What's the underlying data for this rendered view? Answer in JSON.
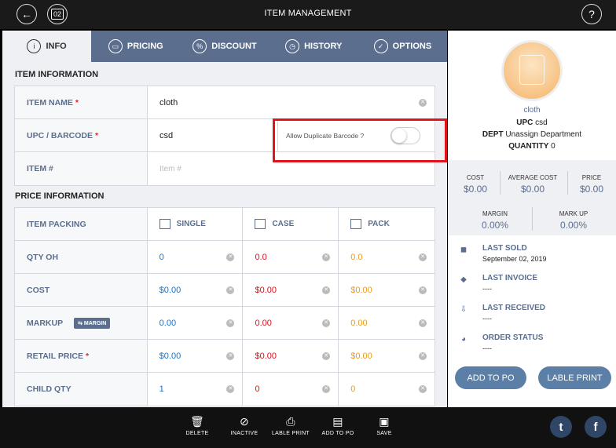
{
  "header": {
    "title": "ITEM MANAGEMENT",
    "back_icon": "←",
    "calendar_label": "02",
    "help_icon": "?"
  },
  "tabs": [
    {
      "label": "INFO",
      "icon": "i"
    },
    {
      "label": "PRICING",
      "icon": "▭"
    },
    {
      "label": "DISCOUNT",
      "icon": "%"
    },
    {
      "label": "HISTORY",
      "icon": "◷"
    },
    {
      "label": "OPTIONS",
      "icon": "✓"
    }
  ],
  "item_info": {
    "title": "ITEM INFORMATION",
    "item_name": {
      "label": "ITEM NAME",
      "value": "cloth"
    },
    "upc": {
      "label": "UPC / BARCODE",
      "value": "csd"
    },
    "allow_duplicate": {
      "label": "Allow Duplicate Barcode ?",
      "enabled": false
    },
    "item_number": {
      "label": "ITEM #",
      "placeholder": "Item #"
    }
  },
  "price_info": {
    "title": "PRICE INFORMATION",
    "packing_label": "ITEM PACKING",
    "columns": [
      "SINGLE",
      "CASE",
      "PACK"
    ],
    "rows": [
      {
        "label": "QTY OH",
        "required": false,
        "values": [
          "0",
          "0.0",
          "0.0"
        ]
      },
      {
        "label": "COST",
        "required": false,
        "values": [
          "$0.00",
          "$0.00",
          "$0.00"
        ]
      },
      {
        "label": "MARKUP",
        "required": false,
        "badge": "MARGIN",
        "values": [
          "0.00",
          "0.00",
          "0.00"
        ]
      },
      {
        "label": "RETAIL PRICE",
        "required": true,
        "values": [
          "$0.00",
          "$0.00",
          "$0.00"
        ]
      },
      {
        "label": "CHILD QTY",
        "required": false,
        "values": [
          "1",
          "0",
          "0"
        ]
      }
    ]
  },
  "summary": {
    "name": "cloth",
    "upc_label": "UPC",
    "upc_value": "csd",
    "dept_label": "DEPT",
    "dept_value": "Unassign Department",
    "qty_label": "QUANTITY",
    "qty_value": "0",
    "cost_label": "COST",
    "cost_value": "$0.00",
    "avg_cost_label": "AVERAGE COST",
    "avg_cost_value": "$0.00",
    "price_label": "PRICE",
    "price_value": "$0.00",
    "margin_label": "MARGIN",
    "margin_value": "0.00%",
    "markup_label": "MARK UP",
    "markup_value": "0.00%",
    "last_sold_label": "LAST SOLD",
    "last_sold_value": "September 02, 2019",
    "last_invoice_label": "LAST INVOICE",
    "last_invoice_value": "----",
    "last_received_label": "LAST RECEIVED",
    "last_received_value": "----",
    "order_status_label": "ORDER STATUS",
    "order_status_value": "----",
    "add_to_po": "ADD TO PO",
    "label_print": "LABLE PRINT"
  },
  "bottom_bar": {
    "items": [
      {
        "label": "DELETE",
        "icon": "🗑"
      },
      {
        "label": "INACTIVE",
        "icon": "⊘"
      },
      {
        "label": "LABLE PRINT",
        "icon": "⎙"
      },
      {
        "label": "ADD TO PO",
        "icon": "▤"
      },
      {
        "label": "SAVE",
        "icon": "▣"
      }
    ],
    "twitter_icon": "t",
    "facebook_icon": "f"
  },
  "colors": {
    "accent": "#5b6e8e",
    "blue_value": "#1670c9",
    "red_value": "#d6101c",
    "orange_value": "#eb9a1f",
    "highlight": "#e3131b"
  }
}
